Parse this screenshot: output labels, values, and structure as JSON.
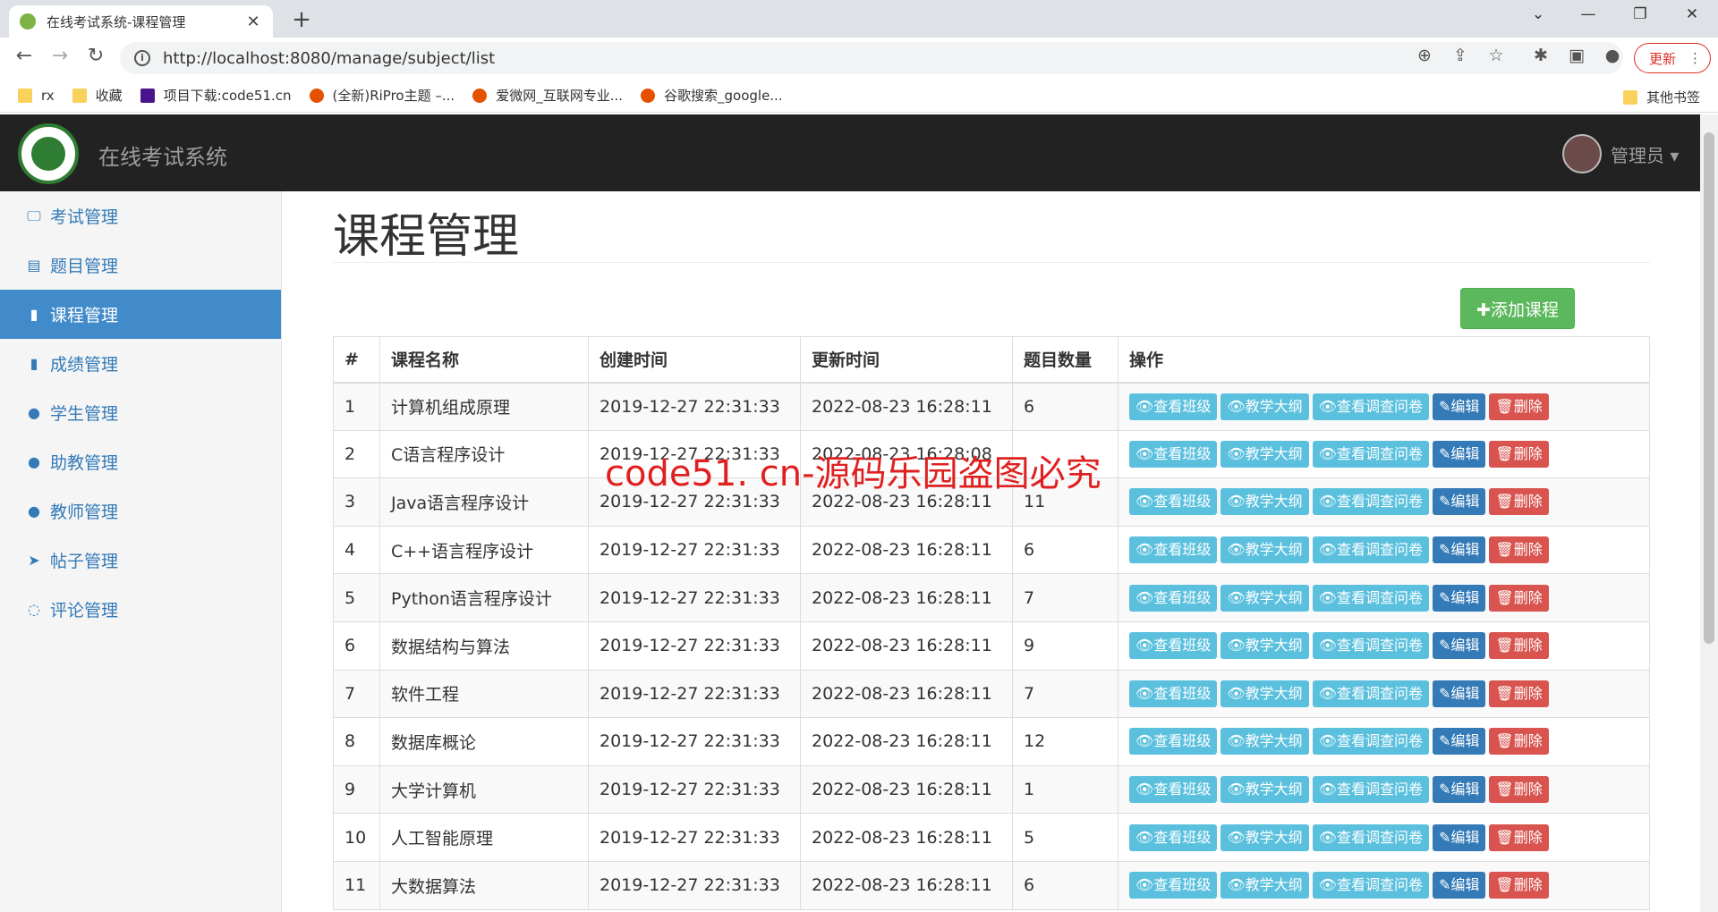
{
  "browser": {
    "tab_title": "在线考试系统-课程管理",
    "url": "http://localhost:8080/manage/subject/list",
    "update_label": "更新",
    "bookmarks": [
      {
        "label": "rx",
        "icon": "folder-icon"
      },
      {
        "label": "收藏",
        "icon": "folder-icon"
      },
      {
        "label": "项目下载:code51.cn",
        "icon": "y-logo-icon"
      },
      {
        "label": "(全新)RiPro主题 –...",
        "icon": "site-icon"
      },
      {
        "label": "爱微网_互联网专业...",
        "icon": "site-icon"
      },
      {
        "label": "谷歌搜索_google...",
        "icon": "site-icon"
      }
    ],
    "other_bookmarks": "其他书签"
  },
  "header": {
    "brand": "在线考试系统",
    "user": "管理员 ▾"
  },
  "sidebar": {
    "items": [
      {
        "label": "考试管理",
        "icon": "monitor-icon",
        "active": false
      },
      {
        "label": "题目管理",
        "icon": "list-icon",
        "active": false
      },
      {
        "label": "课程管理",
        "icon": "book-icon",
        "active": true
      },
      {
        "label": "成绩管理",
        "icon": "bar-chart-icon",
        "active": false
      },
      {
        "label": "学生管理",
        "icon": "user-icon",
        "active": false
      },
      {
        "label": "助教管理",
        "icon": "user-icon",
        "active": false
      },
      {
        "label": "教师管理",
        "icon": "user-icon",
        "active": false
      },
      {
        "label": "帖子管理",
        "icon": "send-icon",
        "active": false
      },
      {
        "label": "评论管理",
        "icon": "comment-icon",
        "active": false
      }
    ]
  },
  "main": {
    "title": "课程管理",
    "add_button": "✚添加课程",
    "columns": [
      "#",
      "课程名称",
      "创建时间",
      "更新时间",
      "题目数量",
      "操作"
    ],
    "actions": {
      "view_class": "👁查看班级",
      "syllabus": "👁教学大纲",
      "survey": "👁查看调查问卷",
      "edit": "✎编辑",
      "delete": "🗑删除"
    },
    "rows": [
      {
        "id": "1",
        "name": "计算机组成原理",
        "created": "2019-12-27 22:31:33",
        "updated": "2022-08-23 16:28:11",
        "count": "6"
      },
      {
        "id": "2",
        "name": "C语言程序设计",
        "created": "2019-12-27 22:31:33",
        "updated": "2022-08-23 16:28:08",
        "count": ""
      },
      {
        "id": "3",
        "name": "Java语言程序设计",
        "created": "2019-12-27 22:31:33",
        "updated": "2022-08-23 16:28:11",
        "count": "11"
      },
      {
        "id": "4",
        "name": "C++语言程序设计",
        "created": "2019-12-27 22:31:33",
        "updated": "2022-08-23 16:28:11",
        "count": "6"
      },
      {
        "id": "5",
        "name": "Python语言程序设计",
        "created": "2019-12-27 22:31:33",
        "updated": "2022-08-23 16:28:11",
        "count": "7"
      },
      {
        "id": "6",
        "name": "数据结构与算法",
        "created": "2019-12-27 22:31:33",
        "updated": "2022-08-23 16:28:11",
        "count": "9"
      },
      {
        "id": "7",
        "name": "软件工程",
        "created": "2019-12-27 22:31:33",
        "updated": "2022-08-23 16:28:11",
        "count": "7"
      },
      {
        "id": "8",
        "name": "数据库概论",
        "created": "2019-12-27 22:31:33",
        "updated": "2022-08-23 16:28:11",
        "count": "12"
      },
      {
        "id": "9",
        "name": "大学计算机",
        "created": "2019-12-27 22:31:33",
        "updated": "2022-08-23 16:28:11",
        "count": "1"
      },
      {
        "id": "10",
        "name": "人工智能原理",
        "created": "2019-12-27 22:31:33",
        "updated": "2022-08-23 16:28:11",
        "count": "5"
      },
      {
        "id": "11",
        "name": "大数据算法",
        "created": "2019-12-27 22:31:33",
        "updated": "2022-08-23 16:28:11",
        "count": "6"
      }
    ]
  },
  "watermark": "code51. cn-源码乐园盗图必究"
}
